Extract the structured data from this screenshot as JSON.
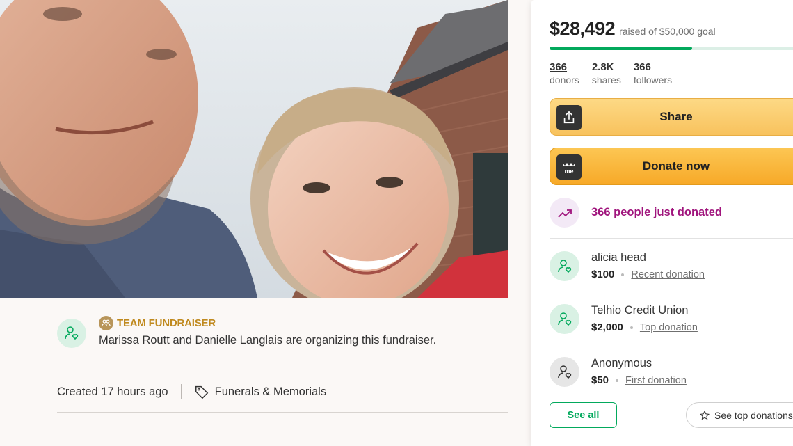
{
  "organizer": {
    "badge": "TEAM FUNDRAISER",
    "description": "Marissa Routt and Danielle Langlais are organizing this fundraiser.",
    "created": "Created 17 hours ago",
    "category": "Funerals & Memorials"
  },
  "campaign": {
    "raised": "$28,492",
    "goal_text": "raised of $50,000 goal",
    "progress_fraction": 0.57,
    "stats": [
      {
        "value": "366",
        "label": "donors"
      },
      {
        "value": "2.8K",
        "label": "shares"
      },
      {
        "value": "366",
        "label": "followers"
      }
    ],
    "share_label": "Share",
    "donate_label": "Donate now",
    "recent_activity": "366 people just donated",
    "donations": [
      {
        "name": "alicia head",
        "amount": "$100",
        "type": "Recent donation"
      },
      {
        "name": "Telhio Credit Union",
        "amount": "$2,000",
        "type": "Top donation"
      },
      {
        "name": "Anonymous",
        "amount": "$50",
        "type": "First donation"
      }
    ],
    "see_all_label": "See all",
    "see_top_label": "See top donations"
  },
  "icons": {
    "organizer": "person-heart-icon",
    "team": "team-icon",
    "category": "tag-icon",
    "share": "share-upload-icon",
    "donate": "gofundme-logo-icon",
    "trend": "trending-up-icon",
    "donor": "person-heart-icon",
    "star": "star-icon"
  },
  "colors": {
    "brand_green": "#02a95c",
    "donate_orange": "#f7a928",
    "share_yellow": "#fdd985",
    "recent_purple": "#a0157d",
    "team_gold": "#c08a1f"
  }
}
